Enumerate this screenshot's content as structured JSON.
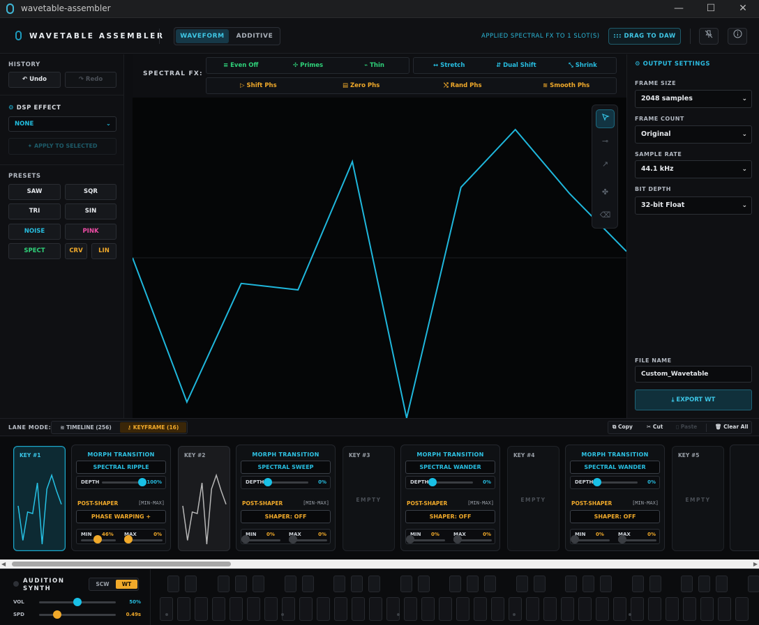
{
  "window": {
    "title": "wavetable-assembler",
    "min": "—",
    "max": "☐",
    "close": "✕"
  },
  "header": {
    "logo": "WAVETABLE ASSEMBLER",
    "tabs": [
      "WAVEFORM",
      "ADDITIVE"
    ],
    "status": "APPLIED SPECTRAL FX TO 1 SLOT(S)",
    "drag": "DRAG TO DAW",
    "drag_icon": "::: "
  },
  "left": {
    "history": "HISTORY",
    "undo": "Undo",
    "redo": "Redo",
    "dsp": "DSP EFFECT",
    "dsp_value": "NONE",
    "apply": "APPLY TO SELECTED",
    "presets": "PRESETS",
    "preset_btns": [
      {
        "l": "SAW",
        "c": "#e6e9ed"
      },
      {
        "l": "SQR",
        "c": "#e6e9ed"
      },
      {
        "l": "TRI",
        "c": "#e6e9ed"
      },
      {
        "l": "SIN",
        "c": "#e6e9ed"
      },
      {
        "l": "NOISE",
        "c": "#27bfe1"
      },
      {
        "l": "PINK",
        "c": "#ee4da6"
      },
      {
        "l": "SPECT",
        "c": "#2fd27a"
      },
      {
        "l": "CRV",
        "c": "#f0a92a"
      },
      {
        "l": "LIN",
        "c": "#f0a92a"
      }
    ]
  },
  "spectral": {
    "label": "SPECTRAL FX:",
    "row1a": [
      {
        "i": "≡",
        "l": "Even Off"
      },
      {
        "i": "✣",
        "l": "Primes"
      },
      {
        "i": "⌁",
        "l": "Thin"
      }
    ],
    "row1b": [
      {
        "i": "↔",
        "l": "Stretch"
      },
      {
        "i": "⇵",
        "l": "Dual Shift"
      },
      {
        "i": "⤡",
        "l": "Shrink"
      }
    ],
    "row2": [
      {
        "i": "▷",
        "l": "Shift Phs"
      },
      {
        "i": "▤",
        "l": "Zero Phs"
      },
      {
        "i": "⤭",
        "l": "Rand Phs"
      },
      {
        "i": "≋",
        "l": "Smooth Phs"
      }
    ]
  },
  "waveform": {
    "points": [
      [
        0,
        0.5
      ],
      [
        0.11,
        0.95
      ],
      [
        0.22,
        0.58
      ],
      [
        0.335,
        0.6
      ],
      [
        0.445,
        0.2
      ],
      [
        0.555,
        1.0
      ],
      [
        0.665,
        0.28
      ],
      [
        0.775,
        0.1
      ],
      [
        0.885,
        0.3
      ],
      [
        1.0,
        0.48
      ]
    ]
  },
  "right": {
    "output": "OUTPUT SETTINGS",
    "frame_size": "FRAME SIZE",
    "frame_size_v": "2048 samples",
    "frame_count": "FRAME COUNT",
    "frame_count_v": "Original",
    "sample_rate": "SAMPLE RATE",
    "sample_rate_v": "44.1 kHz",
    "bit_depth": "BIT DEPTH",
    "bit_depth_v": "32-bit Float",
    "file_name": "FILE NAME",
    "file_name_v": "Custom_Wavetable",
    "export": "EXPORT WT"
  },
  "lane": {
    "mode": "LANE MODE:",
    "timeline": "TIMELINE (256)",
    "keyframe": "KEYFRAME (16)",
    "copy": "Copy",
    "cut": "Cut",
    "paste": "Paste",
    "clear": "Clear All"
  },
  "keys": [
    {
      "label": "KEY #1",
      "state": "active"
    },
    {
      "label": "KEY #2",
      "state": "filled"
    },
    {
      "label": "KEY #3",
      "state": "empty",
      "empty": "EMPTY"
    },
    {
      "label": "KEY #4",
      "state": "empty",
      "empty": "EMPTY"
    },
    {
      "label": "KEY #5",
      "state": "empty",
      "empty": "EMPTY"
    }
  ],
  "morphs": [
    {
      "title": "MORPH TRANSITION",
      "type": "SPECTRAL RIPPLE",
      "depth_label": "DEPTH",
      "depth": "100%",
      "depth_f": 1.0,
      "ps": "POST-SHAPER",
      "range": "[MIN-MAX]",
      "shaper": "PHASE WARPING +",
      "shaper_c": "#f0a92a",
      "min_l": "MIN",
      "min_v": "46%",
      "min_f": 0.46,
      "max_l": "MAX",
      "max_v": "0%",
      "max_f": 0.0,
      "active": true
    },
    {
      "title": "MORPH TRANSITION",
      "type": "SPECTRAL SWEEP",
      "depth_label": "DEPTH",
      "depth": "0%",
      "depth_f": 0.0,
      "ps": "POST-SHAPER",
      "range": "[MIN-MAX]",
      "shaper": "SHAPER: OFF",
      "shaper_c": "#f0a92a",
      "min_l": "MIN",
      "min_v": "0%",
      "min_f": 0.0,
      "max_l": "MAX",
      "max_v": "0%",
      "max_f": 0.0,
      "active": false
    },
    {
      "title": "MORPH TRANSITION",
      "type": "SPECTRAL WANDER",
      "depth_label": "DEPTH",
      "depth": "0%",
      "depth_f": 0.0,
      "ps": "POST-SHAPER",
      "range": "[MIN-MAX]",
      "shaper": "SHAPER: OFF",
      "shaper_c": "#f0a92a",
      "min_l": "MIN",
      "min_v": "0%",
      "min_f": 0.0,
      "max_l": "MAX",
      "max_v": "0%",
      "max_f": 0.0,
      "active": false
    },
    {
      "title": "MORPH TRANSITION",
      "type": "SPECTRAL WANDER",
      "depth_label": "DEPTH",
      "depth": "0%",
      "depth_f": 0.0,
      "ps": "POST-SHAPER",
      "range": "[MIN-MAX]",
      "shaper": "SHAPER: OFF",
      "shaper_c": "#f0a92a",
      "min_l": "MIN",
      "min_v": "0%",
      "min_f": 0.0,
      "max_l": "MAX",
      "max_v": "0%",
      "max_f": 0.0,
      "active": false
    }
  ],
  "audition": {
    "title1": "AUDITION",
    "title2": "SYNTH",
    "scw": "SCW",
    "wt": "WT",
    "vol": "VOL",
    "vol_v": "50%",
    "vol_f": 0.5,
    "spd": "SPD",
    "spd_v": "0.49s",
    "spd_f": 0.05
  },
  "colors": {
    "accent": "#21b8da",
    "orange": "#f0a92a",
    "pink": "#ee4da6",
    "green": "#2fd27a"
  }
}
